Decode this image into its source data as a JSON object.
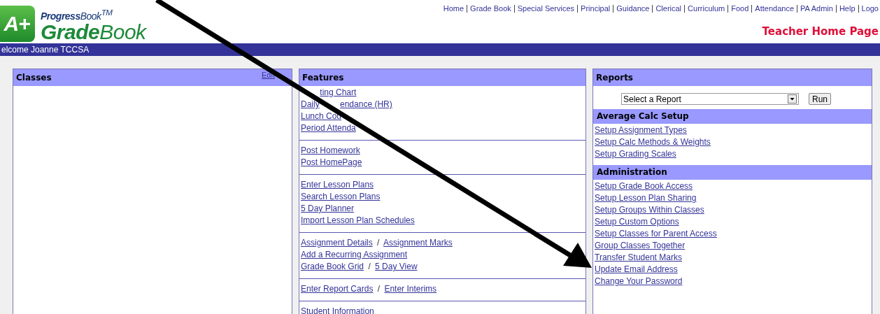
{
  "logo": {
    "badge": "A+",
    "brand": "**Progress**Book$^{TM}$",
    "product": "**Grade**Book"
  },
  "nav": [
    "Home",
    "Grade Book",
    "Special Services",
    "Principal",
    "Guidance",
    "Clerical",
    "Curriculum",
    "Food",
    "Attendance",
    "PA Admin",
    "Help",
    "Logo"
  ],
  "page_title": "Teacher Home Page",
  "welcome": "elcome Joanne TCCSA",
  "classes": {
    "title": "Classes",
    "action": "Edit"
  },
  "features": {
    "title": "Features",
    "groups": [
      [
        {
          "links": [
            "ting Chart"
          ],
          "kind": "leadgap"
        },
        {
          "links": [
            "Daily",
            "endance (HR)"
          ],
          "kind": "midgap"
        },
        {
          "links": [
            "Lunch Cou"
          ]
        },
        {
          "links": [
            "Period Attenda"
          ]
        }
      ],
      [
        {
          "links": [
            "Post Homework"
          ]
        },
        {
          "links": [
            "Post HomePage"
          ]
        }
      ],
      [
        {
          "links": [
            "Enter Lesson Plans"
          ]
        },
        {
          "links": [
            "Search Lesson Plans"
          ]
        },
        {
          "links": [
            "5 Day Planner"
          ]
        },
        {
          "links": [
            "Import Lesson Plan Schedules"
          ]
        }
      ],
      [
        {
          "links": [
            "Assignment Details",
            "Assignment Marks"
          ],
          "separator": "/"
        },
        {
          "links": [
            "Add a Recurring Assignment"
          ]
        },
        {
          "links": [
            "Grade Book Grid",
            "5 Day View"
          ],
          "separator": "/"
        }
      ],
      [
        {
          "links": [
            "Enter Report Cards",
            "Enter Interims"
          ],
          "separator": "/"
        }
      ],
      [
        {
          "links": [
            "Student Information"
          ]
        }
      ]
    ]
  },
  "reports": {
    "title": "Reports",
    "select": "Select a Report",
    "run": "Run",
    "sections": [
      {
        "title": "Average Calc Setup",
        "links": [
          "Setup Assignment Types",
          "Setup Calc Methods & Weights",
          "Setup Grading Scales"
        ]
      },
      {
        "title": "Administration",
        "links": [
          "Setup Grade Book Access",
          "Setup Lesson Plan Sharing",
          "Setup Groups Within Classes",
          "Setup Custom Options",
          "Setup Classes for Parent Access",
          "Group Classes Together",
          "Transfer Student Marks",
          "Update Email Address",
          "Change Your Password"
        ]
      }
    ]
  }
}
